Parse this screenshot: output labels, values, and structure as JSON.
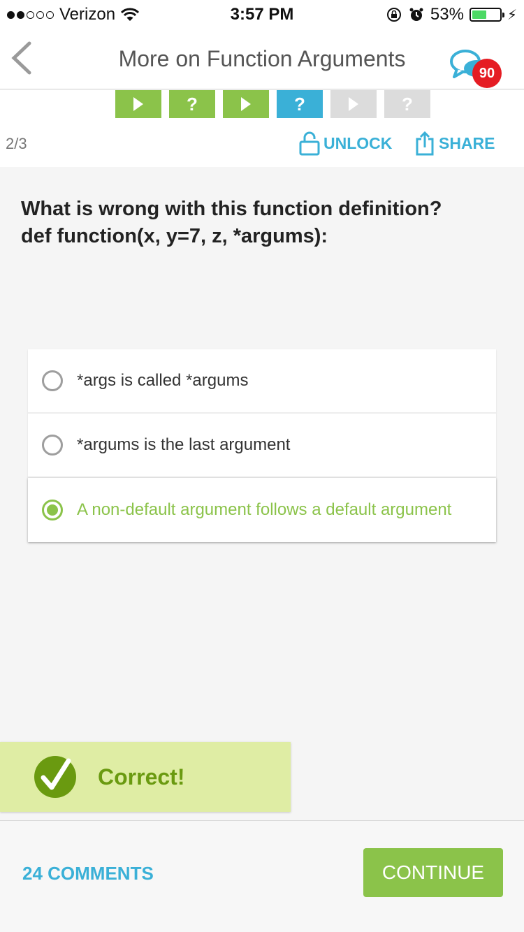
{
  "status_bar": {
    "carrier": "Verizon",
    "time": "3:57 PM",
    "battery": "53%",
    "battery_level": 0.53
  },
  "nav": {
    "title": "More on Function Arguments",
    "badge_count": "90"
  },
  "progress": {
    "steps": [
      {
        "type": "play",
        "state": "done"
      },
      {
        "type": "quiz",
        "state": "done",
        "label": "?"
      },
      {
        "type": "play",
        "state": "done"
      },
      {
        "type": "quiz",
        "state": "current",
        "label": "?"
      },
      {
        "type": "play",
        "state": "locked"
      },
      {
        "type": "quiz",
        "state": "locked",
        "label": "?"
      }
    ],
    "page_indicator": "2/3",
    "unlock_label": "UNLOCK",
    "share_label": "SHARE"
  },
  "question": {
    "line1": "What is wrong with this function definition?",
    "line2": "def function(x, y=7, z, *argums):"
  },
  "answers": [
    {
      "text": "*args is called *argums",
      "selected": false
    },
    {
      "text": "*argums is the last argument",
      "selected": false
    },
    {
      "text": "A non-default argument follows a default argument",
      "selected": true
    }
  ],
  "result": {
    "label": "Correct!"
  },
  "footer": {
    "comments_label": "24 COMMENTS",
    "continue_label": "CONTINUE"
  },
  "colors": {
    "green": "#8bc34a",
    "blue": "#3ab0d7",
    "badge_red": "#e51c23"
  }
}
